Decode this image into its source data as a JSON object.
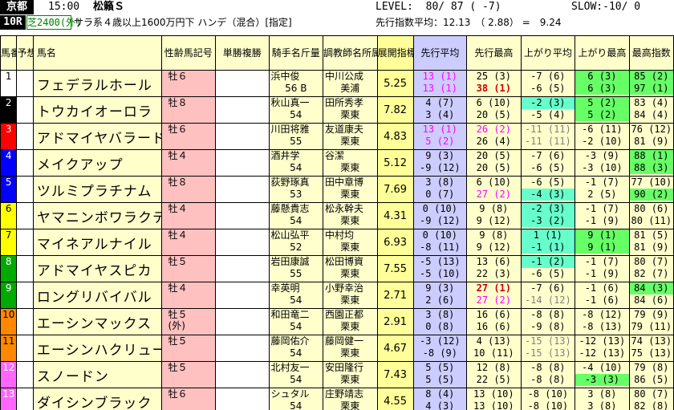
{
  "header": {
    "venue": "京都",
    "time": "15:00",
    "race_name": "松籟Ｓ",
    "level": "LEVEL:  80/ 87 ( -7)",
    "slow": "SLOW:-10/ 0",
    "race_no": "10R",
    "condition": "芝2400(外)",
    "race_class": "サラ系４歳以上1600万円下 ハンデ（混合）[指定]",
    "avg_label": "先行指数平均：12.13　（ 2.88） =　9.24"
  },
  "columns": {
    "umaban": "馬番",
    "yosou": "予想",
    "horse": "馬名",
    "sexage": "性齢馬記号",
    "odds": "単勝複勝",
    "jockey": "騎手名斤量",
    "trainer": "調教師名所属",
    "tenkai": "展開指標",
    "senko_avg": "先行平均",
    "senko_max": "先行最高",
    "agari_avg": "上がり平均",
    "agari_max": "上がり最高",
    "max_index": "最高指数"
  },
  "colors": {
    "header_black": "#000000",
    "row_bg": "#ffffcc",
    "sex_bg": "#ffc0c0",
    "blue_col": "#ccccff",
    "cyan_hl": "#66ffcc",
    "green_hl": "#66ff66",
    "magenta": "#ff00ff",
    "red": "#cc0000"
  },
  "rows": [
    {
      "no": "1",
      "numbg": "#ffffff",
      "numfg": "#000000",
      "name": "フェデラルホール",
      "sex": "牡６",
      "sex2": "",
      "jockey": "浜中俊",
      "weight": "56 B",
      "trainer": "中川公成",
      "tloc": "美浦",
      "tenkai": "5.25",
      "sa1": "13 (1)",
      "sa2": "13 (1)",
      "sm1": "25 (3)",
      "sm2": "38 (1)",
      "aa1": "-7 (6)",
      "aa2": "-6 (5)",
      "am1": "6 (3)",
      "am2": "6 (3)",
      "mx1": "85 (2)",
      "mx2": "97 (1)"
    },
    {
      "no": "2",
      "numbg": "#000000",
      "numfg": "#ffffff",
      "name": "トウカイオーロラ",
      "sex": "牡８",
      "sex2": "",
      "jockey": "秋山真一",
      "weight": "54",
      "trainer": "田所秀孝",
      "tloc": "栗東",
      "tenkai": "7.82",
      "sa1": "4 (7)",
      "sa2": "3 (4)",
      "sm1": "6 (10)",
      "sm2": "20 (5)",
      "aa1": "-2 (3)",
      "aa2": "-5 (4)",
      "am1": "5 (2)",
      "am2": "5 (2)",
      "mx1": "83 (4)",
      "mx2": "84 (4)"
    },
    {
      "no": "3",
      "numbg": "#ff0000",
      "numfg": "#ffffff",
      "name": "アドマイヤバラード",
      "sex": "牡６",
      "sex2": "",
      "jockey": "川田将雅",
      "weight": "55",
      "trainer": "友道康夫",
      "tloc": "栗東",
      "tenkai": "4.83",
      "sa1": "13 (1)",
      "sa2": "5 (2)",
      "sm1": "26 (2)",
      "sm2": "26 (4)",
      "aa1": "-11 (11)",
      "aa2": "-11 (11)",
      "am1": "-6 (11)",
      "am2": "-2 (10)",
      "mx1": "76 (12)",
      "mx2": "81 (9)"
    },
    {
      "no": "4",
      "numbg": "#0000ff",
      "numfg": "#ffffff",
      "name": "メイクアップ",
      "sex": "牡４",
      "sex2": "",
      "jockey": "酒井学",
      "weight": "54",
      "trainer": "谷潔",
      "tloc": "栗東",
      "tenkai": "5.12",
      "sa1": "9 (3)",
      "sa2": "-9 (12)",
      "sm1": "20 (5)",
      "sm2": "20 (5)",
      "aa1": "-7 (6)",
      "aa2": "-6 (5)",
      "am1": "-3 (9)",
      "am2": "-3 (10)",
      "mx1": "88 (1)",
      "mx2": "88 (3)"
    },
    {
      "no": "5",
      "numbg": "#0000ff",
      "numfg": "#ffffff",
      "name": "ツルミプラチナム",
      "sex": "牡８",
      "sex2": "",
      "jockey": "荻野琢真",
      "weight": "53",
      "trainer": "田中章博",
      "tloc": "栗東",
      "tenkai": "7.69",
      "sa1": "3 (8)",
      "sa2": "0 (7)",
      "sm1": "6 (10)",
      "sm2": "27 (2)",
      "aa1": "-6 (5)",
      "aa2": "-4 (3)",
      "am1": "-1 (7)",
      "am2": "2 (5)",
      "mx1": "77 (10)",
      "mx2": "90 (2)"
    },
    {
      "no": "6",
      "numbg": "#ffff00",
      "numfg": "#000000",
      "name": "ヤマニンボワラクテ",
      "sex": "牡４",
      "sex2": "",
      "jockey": "藤懸貴志",
      "weight": "54",
      "trainer": "松永幹夫",
      "tloc": "栗東",
      "tenkai": "4.31",
      "sa1": "0 (10)",
      "sa2": "-9 (12)",
      "sm1": "9 (8)",
      "sm2": "9 (12)",
      "aa1": "-2 (3)",
      "aa2": "-3 (2)",
      "am1": "-1 (7)",
      "am2": "-1 (9)",
      "mx1": "80 (6)",
      "mx2": "80 (11)"
    },
    {
      "no": "7",
      "numbg": "#ffff00",
      "numfg": "#000000",
      "name": "マイネアルナイル",
      "sex": "牡４",
      "sex2": "",
      "jockey": "松山弘平",
      "weight": "52",
      "trainer": "中村均",
      "tloc": "栗東",
      "tenkai": "6.93",
      "sa1": "0 (10)",
      "sa2": "-8 (11)",
      "sm1": "9 (8)",
      "sm2": "9 (12)",
      "aa1": "1 (1)",
      "aa2": "-1 (1)",
      "am1": "9 (1)",
      "am2": "9 (1)",
      "mx1": "81 (5)",
      "mx2": "81 (9)"
    },
    {
      "no": "8",
      "numbg": "#00aa00",
      "numfg": "#ffffff",
      "name": "アドマイヤスピカ",
      "sex": "牡５",
      "sex2": "",
      "jockey": "岩田康誠",
      "weight": "55",
      "trainer": "松田博資",
      "tloc": "栗東",
      "tenkai": "7.55",
      "sa1": "-5 (13)",
      "sa2": "-5 (10)",
      "sm1": "13 (6)",
      "sm2": "22 (3)",
      "aa1": "-1 (2)",
      "aa2": "-6 (5)",
      "am1": "-1 (7)",
      "am2": "-1 (9)",
      "mx1": "80 (7)",
      "mx2": "82 (7)"
    },
    {
      "no": "9",
      "numbg": "#00aa00",
      "numfg": "#ffffff",
      "name": "ロングリバイバル",
      "sex": "牡４",
      "sex2": "",
      "jockey": "幸英明",
      "weight": "54",
      "trainer": "小野幸治",
      "tloc": "栗東",
      "tenkai": "2.71",
      "sa1": "9 (3)",
      "sa2": "2 (6)",
      "sm1": "27 (1)",
      "sm2": "27 (2)",
      "aa1": "-7 (6)",
      "aa2": "-14 (12)",
      "am1": "-1 (6)",
      "am2": "-1 (6)",
      "mx1": "84 (3)",
      "mx2": "84 (6)"
    },
    {
      "no": "10",
      "numbg": "#ff8800",
      "numfg": "#000000",
      "name": "エーシンマックス",
      "sex": "牡５",
      "sex2": "(外)",
      "jockey": "和田竜二",
      "weight": "54",
      "trainer": "西園正都",
      "tloc": "栗東",
      "tenkai": "2.91",
      "sa1": "3 (8)",
      "sa2": "0 (8)",
      "sm1": "16 (6)",
      "sm2": "16 (6)",
      "aa1": "-8 (8)",
      "aa2": "-9 (8)",
      "am1": "-8 (12)",
      "am2": "-8 (13)",
      "mx1": "79 (9)",
      "mx2": "79 (11)"
    },
    {
      "no": "11",
      "numbg": "#ff8800",
      "numfg": "#000000",
      "name": "エーシンハクリュー",
      "sex": "牡５",
      "sex2": "",
      "jockey": "藤岡佑介",
      "weight": "54",
      "trainer": "藤岡健一",
      "tloc": "栗東",
      "tenkai": "4.67",
      "sa1": "-3 (12)",
      "sa2": "-8 (9)",
      "sm1": "4 (13)",
      "sm2": "10 (11)",
      "aa1": "-15 (13)",
      "aa2": "-15 (13)",
      "am1": "-12 (13)",
      "am2": "-12 (13)",
      "mx1": "74 (13)",
      "mx2": "75 (13)"
    },
    {
      "no": "12",
      "numbg": "#ff66ff",
      "numfg": "#ffffff",
      "name": "スノードン",
      "sex": "牡５",
      "sex2": "",
      "jockey": "北村友一",
      "weight": "54",
      "trainer": "安田隆行",
      "tloc": "栗東",
      "tenkai": "7.43",
      "sa1": "5 (5)",
      "sa2": "5 (5)",
      "sm1": "12 (8)",
      "sm2": "22 (5)",
      "aa1": "-8 (8)",
      "aa2": "-8 (8)",
      "am1": "-4 (10)",
      "am2": "-3 (3)",
      "mx1": "79 (8)",
      "mx2": "86 (5)"
    },
    {
      "no": "13",
      "numbg": "#ff66ff",
      "numfg": "#ffffff",
      "name": "ダイシンブラック",
      "sex": "牡６",
      "sex2": "",
      "jockey": "シュタル",
      "weight": "54",
      "trainer": "庄野靖志",
      "tloc": "栗東",
      "tenkai": "4.55",
      "sa1": "8 (4)",
      "sa2": "4 (3)",
      "sm1": "13 (10)",
      "sm2": "13 (10)",
      "aa1": "-8 (10)",
      "aa2": "-8 (10)",
      "am1": "3 (8)",
      "am2": "3 (8)",
      "mx1": "80 (7)",
      "mx2": "82 (8)"
    }
  ]
}
